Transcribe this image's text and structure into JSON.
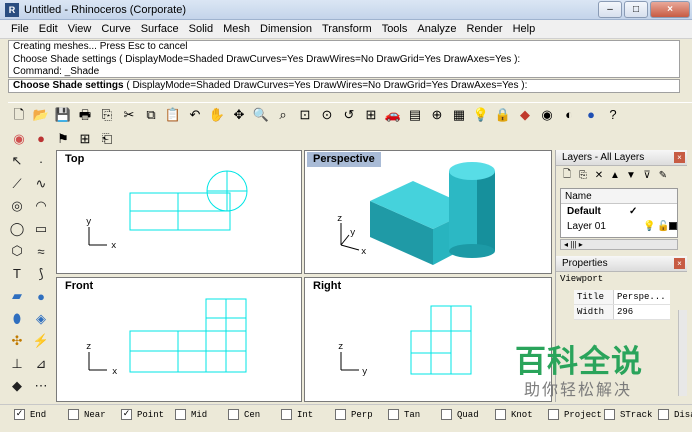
{
  "window": {
    "title": "Untitled - Rhinoceros (Corporate)",
    "app_icon": "R",
    "min_label": "–",
    "max_label": "□",
    "close_label": "×"
  },
  "menu": [
    "File",
    "Edit",
    "View",
    "Curve",
    "Surface",
    "Solid",
    "Mesh",
    "Dimension",
    "Transform",
    "Tools",
    "Analyze",
    "Render",
    "Help"
  ],
  "command_history": [
    "Creating meshes... Press Esc to cancel",
    "Choose Shade settings ( DisplayMode=Shaded  DrawCurves=Yes  DrawWires=No  DrawGrid=Yes  DrawAxes=Yes ):",
    "Command: _Shade"
  ],
  "command_prompt": {
    "label": "Choose Shade settings",
    "rest": " ( DisplayMode=Shaded  DrawCurves=Yes  DrawWires=No  DrawGrid=Yes  DrawAxes=Yes ):"
  },
  "toolbar_icons": [
    "new-file-icon",
    "open-icon",
    "save-icon",
    "print-icon",
    "import-icon",
    "cut-icon",
    "copy-icon",
    "paste-icon",
    "undo-icon",
    "pan-hand-icon",
    "rotate-view-icon",
    "zoom-icon",
    "zoom-window-icon",
    "zoom-extents-icon",
    "zoom-selected-icon",
    "undo-view-icon",
    "four-viewports-icon",
    "car-icon",
    "layer-icon",
    "point-icon",
    "properties-icon",
    "bulb-icon",
    "lock-icon",
    "render-icon",
    "color-wheel-icon",
    "sphere-icon",
    "sphere-shaded-icon",
    "help-icon"
  ],
  "viewports": {
    "top": {
      "label": "Top",
      "axis_x": "x",
      "axis_y": "y"
    },
    "perspective": {
      "label": "Perspective",
      "axis_x": "x",
      "axis_y": "y",
      "axis_z": "z"
    },
    "front": {
      "label": "Front",
      "axis_x": "x",
      "axis_z": "z"
    },
    "right": {
      "label": "Right",
      "axis_y": "y",
      "axis_z": "z"
    }
  },
  "layers_panel": {
    "title": "Layers - All Layers",
    "column_name": "Name",
    "rows": [
      {
        "name": "Default",
        "current": "✓"
      },
      {
        "name": "Layer 01"
      }
    ],
    "scroll_text": "◂ ||| ▸"
  },
  "properties_panel": {
    "title": "Properties",
    "subtitle": "Viewport",
    "rows": [
      {
        "key": "Title",
        "value": "Perspe..."
      },
      {
        "key": "Width",
        "value": "296"
      }
    ]
  },
  "osnaps": [
    {
      "label": "End",
      "checked": true
    },
    {
      "label": "Near",
      "checked": false
    },
    {
      "label": "Point",
      "checked": true
    },
    {
      "label": "Mid",
      "checked": false
    },
    {
      "label": "Cen",
      "checked": false
    },
    {
      "label": "Int",
      "checked": false
    },
    {
      "label": "Perp",
      "checked": false
    },
    {
      "label": "Tan",
      "checked": false
    },
    {
      "label": "Quad",
      "checked": false
    },
    {
      "label": "Knot",
      "checked": false
    },
    {
      "label": "Project",
      "checked": false
    },
    {
      "label": "STrack",
      "checked": false
    },
    {
      "label": "Disable",
      "checked": false
    }
  ],
  "watermark": {
    "main": "百科全说",
    "sub": "助你轻松解决"
  },
  "colors": {
    "curve": "#00e5e5",
    "solid_light": "#37c9d3",
    "solid_dark": "#168a96",
    "active_title": "#a9bbd6"
  }
}
